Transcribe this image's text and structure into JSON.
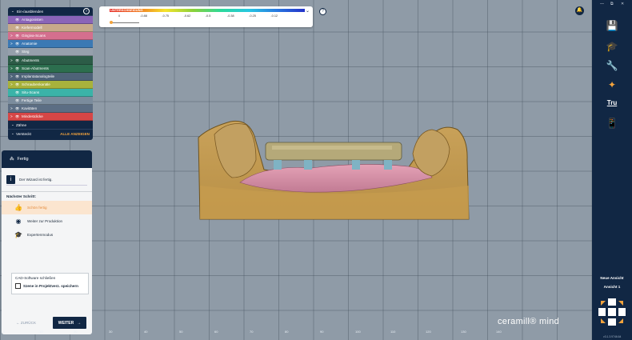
{
  "layer_panel": {
    "title": "Ein-/ausblenden",
    "help": "?",
    "items": [
      {
        "label": "Antagonisten",
        "color": "#8a64b8",
        "chevron": ""
      },
      {
        "label": "Kiefermodell",
        "color": "#c7a98a",
        "chevron": ""
      },
      {
        "label": "Gingiva-Scans",
        "color": "#d46f8e",
        "chevron": ">"
      },
      {
        "label": "Anatomie",
        "color": "#3b79b4",
        "chevron": ">"
      },
      {
        "label": "Steg",
        "color": "#96a0ac",
        "chevron": ""
      },
      {
        "label": "Abutments",
        "color": "#2c5c47",
        "chevron": ">"
      },
      {
        "label": "Scan-Abutments",
        "color": "#2c6e4e",
        "chevron": ">"
      },
      {
        "label": "Implantatanalogteile",
        "color": "#4e6378",
        "chevron": ">"
      },
      {
        "label": "Schraubenkanäle",
        "color": "#a8b23c",
        "chevron": ">"
      },
      {
        "label": "Situ-Scans",
        "color": "#3bb3a8",
        "chevron": ""
      },
      {
        "label": "Fertige Teile",
        "color": "#7b8c9d",
        "chevron": ""
      },
      {
        "label": "Kavitäten",
        "color": "#5c6e84",
        "chevron": ">"
      },
      {
        "label": "Mindestdicke",
        "color": "#d64646",
        "chevron": ">"
      }
    ],
    "teeth": "Zähne",
    "hidden": "Versteckt",
    "show_all": "ALLE ANZEIGEN"
  },
  "wizard": {
    "title": "Fertig",
    "info": "Der Wizard ist fertig.",
    "next_step_heading": "Nächster Schritt:",
    "steps": [
      {
        "label": "Schön fertig",
        "icon": "thumbs-up"
      },
      {
        "label": "Weiter zur Produktion",
        "icon": "globe"
      },
      {
        "label": "Expertenmodus",
        "icon": "mortarboard"
      }
    ],
    "close_cad": "CAD-Software schließen",
    "save_scene": "Szene in Projektverz. speichern",
    "back": "← ZURÜCK",
    "next": "WEITER"
  },
  "color_scale": {
    "label": "UNTERSCHNEIDUNG",
    "ticks": [
      "0",
      "-0.88",
      "-0.75",
      "-0.62",
      "-0.5",
      "-0.38",
      "-0.25",
      "-0.12",
      ""
    ],
    "slider_value": 0
  },
  "sidebar": {
    "window_controls": [
      "—",
      "⧉",
      "✕"
    ],
    "new_view": "Neue Ansicht",
    "view1": "Ansicht 1",
    "tru": "Tru",
    "version": "v3.1.3.9746.64"
  },
  "brand": {
    "logo": "ceramill® mind"
  },
  "ruler": [
    "0",
    ".10",
    "20",
    "30",
    "40",
    "50",
    "60",
    "70",
    "80",
    "90",
    "100",
    "110",
    "120",
    "130",
    "140"
  ]
}
